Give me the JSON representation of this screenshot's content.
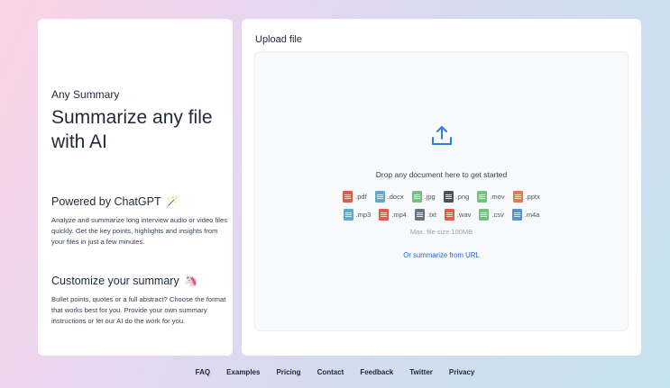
{
  "left_panel": {
    "app_name": "Any Summary",
    "headline": "Summarize any file with AI",
    "section1": {
      "title": "Powered by ChatGPT",
      "emoji": "🪄",
      "body": "Analyze and summarize long interview audio or video files quickly. Get the key points, highlights and insights from your files in just a few minutes."
    },
    "section2": {
      "title": "Customize your summary",
      "emoji": "🦄",
      "body": "Bullet points, quotes or a full abstract? Choose the format that works best for you. Provide your own summary instructions or let our AI do the work for you."
    }
  },
  "upload": {
    "title": "Upload file",
    "icon": "upload-icon",
    "drop_text": "Drop any document here to get started",
    "file_types_row1": [
      {
        "label": ".pdf",
        "color": "#e8584a"
      },
      {
        "label": ".docx",
        "color": "#5aa9d6"
      },
      {
        "label": ".jpg",
        "color": "#6cc57a"
      },
      {
        "label": ".png",
        "color": "#4b4f57"
      },
      {
        "label": ".mov",
        "color": "#6cc57a"
      },
      {
        "label": ".pptx",
        "color": "#e8774a"
      }
    ],
    "file_types_row2": [
      {
        "label": ".mp3",
        "color": "#5aa9d6"
      },
      {
        "label": ".mp4",
        "color": "#e8584a"
      },
      {
        "label": ".txt",
        "color": "#6b7280"
      },
      {
        "label": ".wav",
        "color": "#e8584a"
      },
      {
        "label": ".csv",
        "color": "#6cc57a"
      },
      {
        "label": ".m4a",
        "color": "#5a8fd6"
      }
    ],
    "max_size": "Max. file size 100MB",
    "url_link": "Or summarize from URL",
    "accent_color": "#2f7de1"
  },
  "footer": {
    "links": [
      "FAQ",
      "Examples",
      "Pricing",
      "Contact",
      "Feedback",
      "Twitter",
      "Privacy"
    ]
  }
}
